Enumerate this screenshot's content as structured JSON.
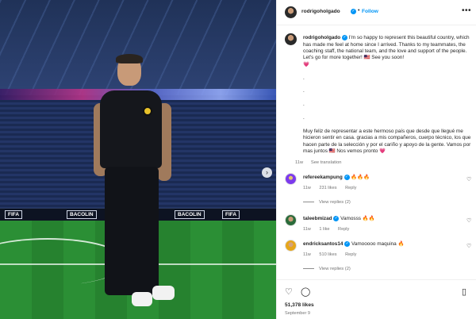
{
  "photo": {
    "boards": [
      "FIFA",
      "BACOLIN",
      "BACOLIN",
      "FIFA",
      "BACOLIN",
      "FIFA"
    ]
  },
  "header": {
    "username": "rodrigoholgado",
    "separator": "•",
    "follow_label": "Follow",
    "more_label": "•••"
  },
  "caption": {
    "username": "rodrigoholgado",
    "text_en": "I'm so happy to represent this beautiful country, which has made me feel at home since I arrived. Thanks to my teammates, the coaching staff, the national team, and the love and support of the people. Let's go for more together! 🇲🇾 See you soon!",
    "heart": "💗",
    "dots": [
      ".",
      ".",
      ".",
      "."
    ],
    "text_es": "Muy feliz de representar a este hermoso país que desde que llegué me hicieron sentir en casa. gracias a mis compañeros, cuerpo técnico, los que hacen parte de la selección y por el cariño y apoyo de la gente. Vamos por mas juntos 🇲🇾 Nos vemos pronto 💗",
    "time": "11w",
    "see_translation": "See translation"
  },
  "comments": [
    {
      "username": "refereekampung",
      "text": "🔥🔥🔥",
      "time": "11w",
      "likes": "231 likes",
      "reply": "Reply",
      "view_replies": "View replies (2)"
    },
    {
      "username": "taleebmizad",
      "text": "Vamosss 🔥🔥",
      "time": "11w",
      "likes": "1 like",
      "reply": "Reply",
      "view_replies": ""
    },
    {
      "username": "endricksantos14",
      "text": "Vamooooo maquina 🔥",
      "time": "11w",
      "likes": "510 likes",
      "reply": "Reply",
      "view_replies": "View replies (2)"
    }
  ],
  "actions": {
    "likes": "51,378 likes",
    "date": "September 9"
  },
  "colors": {
    "accent": "#0095f6",
    "muted": "#737373",
    "text": "#262626"
  }
}
